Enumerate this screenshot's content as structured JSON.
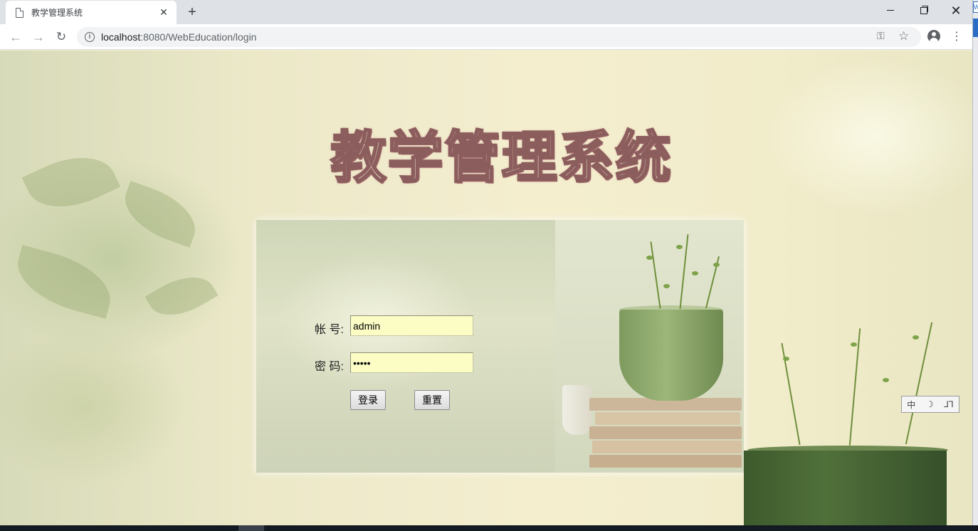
{
  "browser": {
    "tab_title": "教学管理系统",
    "tab_close": "✕",
    "new_tab": "+",
    "window_close": "✕",
    "url_host": "localhost",
    "url_rest": ":8080/WebEducation/login",
    "info_glyph": "i",
    "side_badge": "W"
  },
  "page": {
    "title": "教学管理系统",
    "form": {
      "username_label": "帐 号:",
      "username_value": "admin",
      "password_label": "密 码:",
      "password_value": "admin",
      "login_button": "登录",
      "reset_button": "重置"
    }
  },
  "ime": {
    "mode": "中",
    "moon": "☽",
    "punct": "⅃⅂"
  }
}
